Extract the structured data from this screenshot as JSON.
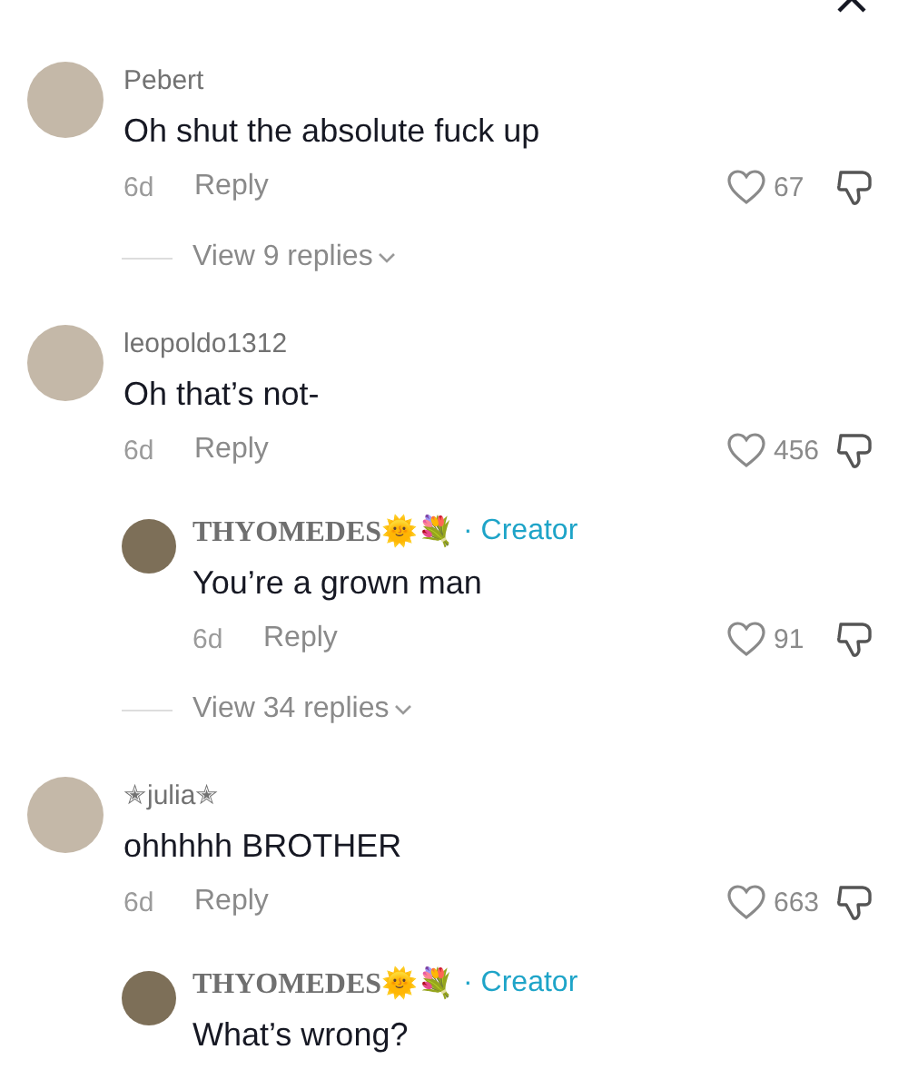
{
  "items": [
    {
      "kind": "comment",
      "username": "Pebert",
      "text": "Oh shut the absolute fuck up",
      "age": "6d",
      "reply_label": "Reply",
      "likes": "67"
    },
    {
      "kind": "view_replies",
      "label": "View 9 replies"
    },
    {
      "kind": "comment",
      "username": "leopoldo1312",
      "text": "Oh that’s not-",
      "age": "6d",
      "reply_label": "Reply",
      "likes": "456"
    },
    {
      "kind": "reply",
      "username": "THYOMEDES🌞💐",
      "badge": "· Creator",
      "text": "You’re a grown man",
      "age": "6d",
      "reply_label": "Reply",
      "likes": "91"
    },
    {
      "kind": "view_replies",
      "label": "View 34 replies"
    },
    {
      "kind": "comment",
      "username": "✭julia✭",
      "text": "ohhhhh BROTHER",
      "age": "6d",
      "reply_label": "Reply",
      "likes": "663"
    },
    {
      "kind": "reply",
      "username": "THYOMEDES🌞💐",
      "badge": "· Creator",
      "text": "What’s wrong?"
    }
  ]
}
